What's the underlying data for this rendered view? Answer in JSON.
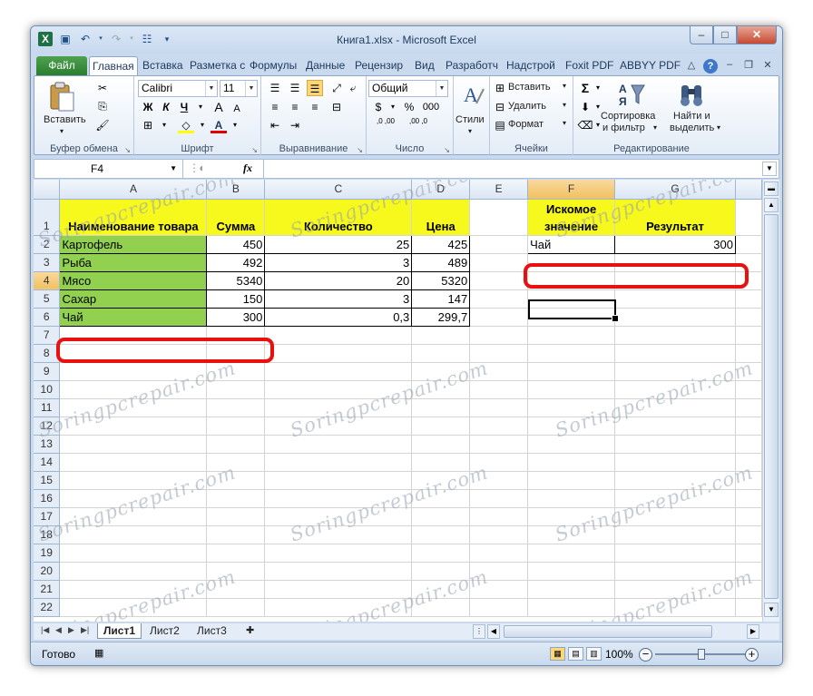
{
  "window": {
    "title": "Книга1.xlsx - Microsoft Excel"
  },
  "ribbon_tabs": [
    "Файл",
    "Главная",
    "Вставка",
    "Разметка с",
    "Формулы",
    "Данные",
    "Рецензир",
    "Вид",
    "Разработч",
    "Надстрой",
    "Foxit PDF",
    "ABBYY PDF"
  ],
  "active_tab": "Главная",
  "ribbon": {
    "clipboard": {
      "paste": "Вставить",
      "label": "Буфер обмена"
    },
    "font": {
      "name": "Calibri",
      "size": "11",
      "bold": "Ж",
      "italic": "К",
      "underline": "Ч",
      "label": "Шрифт"
    },
    "alignment": {
      "label": "Выравнивание"
    },
    "number": {
      "format": "Общий",
      "percent": "%",
      "thousands": "000",
      "dec_inc": ",0 ,00",
      "dec_dec": ",00 ,0",
      "label": "Число"
    },
    "styles": {
      "label": "Стили"
    },
    "cells": {
      "insert": "Вставить",
      "delete": "Удалить",
      "format": "Формат",
      "label": "Ячейки"
    },
    "editing": {
      "sort_filter_1": "Сортировка",
      "sort_filter_2": "и фильтр",
      "find_1": "Найти и",
      "find_2": "выделить",
      "label": "Редактирование"
    }
  },
  "formula_bar": {
    "name_box": "F4",
    "fx": "fx",
    "content": ""
  },
  "columns": [
    "A",
    "B",
    "C",
    "D",
    "E",
    "F",
    "G"
  ],
  "rows": [
    "1",
    "2",
    "3",
    "4",
    "5",
    "6",
    "7",
    "8",
    "9",
    "10",
    "11",
    "12",
    "13",
    "14",
    "15",
    "16",
    "17",
    "18",
    "19",
    "20",
    "21",
    "22"
  ],
  "selected_column": "F",
  "selected_row": "4",
  "table": {
    "headers": [
      "Наименование товара",
      "Сумма",
      "Количество",
      "Цена"
    ],
    "rows": [
      [
        "Картофель",
        "450",
        "25",
        "425"
      ],
      [
        "Рыба",
        "492",
        "3",
        "489"
      ],
      [
        "Мясо",
        "5340",
        "20",
        "5320"
      ],
      [
        "Сахар",
        "150",
        "3",
        "147"
      ],
      [
        "Чай",
        "300",
        "0,3",
        "299,7"
      ]
    ]
  },
  "lookup": {
    "header_f_1": "Искомое",
    "header_f_2": "значение",
    "header_g": "Результат",
    "value": "Чай",
    "result": "300"
  },
  "sheets": [
    "Лист1",
    "Лист2",
    "Лист3"
  ],
  "active_sheet": "Лист1",
  "status": {
    "ready": "Готово",
    "zoom": "100%"
  },
  "watermark": "Soringpcrepair.com",
  "colors": {
    "header_yellow": "#f7f81c",
    "name_green": "#92d050",
    "highlight_red": "#e8110f",
    "file_tab": "#2a7e2d"
  }
}
